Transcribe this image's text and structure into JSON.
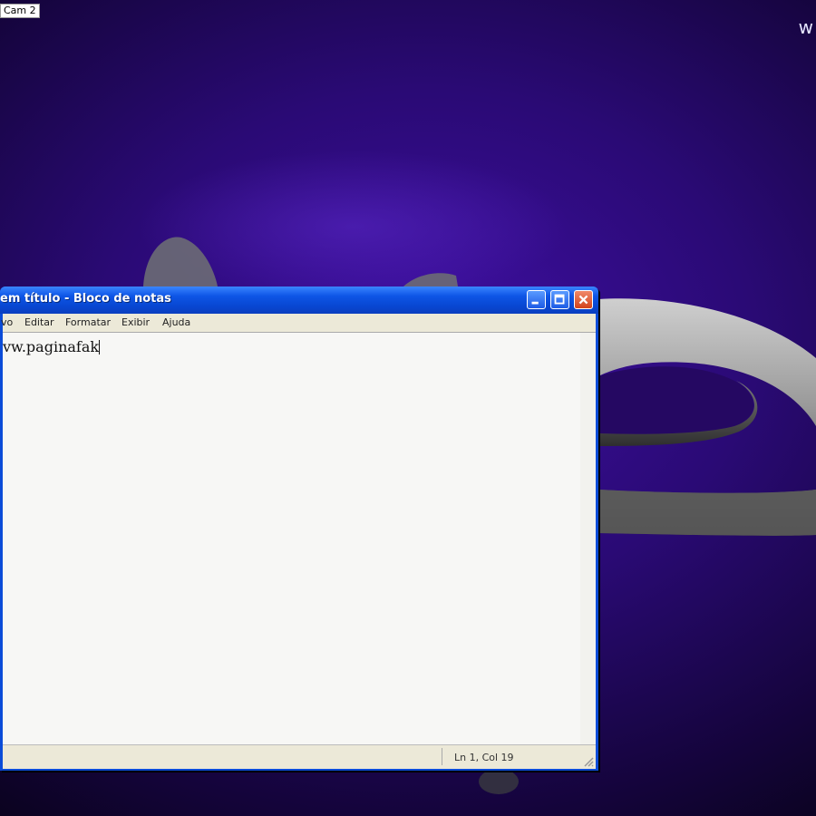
{
  "overlay": {
    "top_label": "Cam 2",
    "corner_mark": "w"
  },
  "window": {
    "title": "em título - Bloco de notas",
    "menu": [
      "vo",
      "Editar",
      "Formatar",
      "Exibir",
      "Ajuda"
    ],
    "content": "vw.paginafak",
    "status": "Ln 1, Col 19"
  },
  "colors": {
    "background": "#2a0a75",
    "titlebar": "#0e55e6",
    "menubar": "#ece9d8",
    "editor": "#f7f7f5",
    "close_button": "#d2421b"
  },
  "icons": [
    "minimize-icon",
    "maximize-icon",
    "close-icon"
  ]
}
